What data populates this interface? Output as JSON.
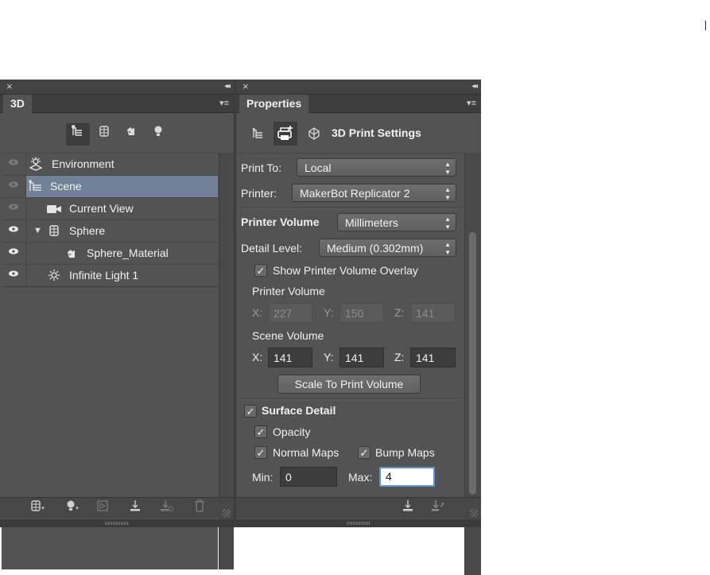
{
  "panel_3d": {
    "close_glyph": "×",
    "collapse_glyph": "◂◂",
    "tab_label": "3D",
    "menu_glyph": "▾≡",
    "filter_icons": [
      "scene-filter-icon",
      "mesh-filter-icon",
      "material-filter-icon",
      "light-filter-icon"
    ],
    "layers": [
      {
        "name": "Environment",
        "icon": "environment-icon",
        "visible": false,
        "selected": false,
        "indent": 0
      },
      {
        "name": "Scene",
        "icon": "scene-icon",
        "visible": false,
        "selected": true,
        "indent": 0
      },
      {
        "name": "Current View",
        "icon": "camera-icon",
        "visible": false,
        "selected": false,
        "indent": 1
      },
      {
        "name": "Sphere",
        "icon": "mesh-icon",
        "visible": true,
        "selected": false,
        "indent": 1,
        "expanded": true
      },
      {
        "name": "Sphere_Material",
        "icon": "material-icon",
        "visible": true,
        "selected": false,
        "indent": 2
      },
      {
        "name": "Infinite Light 1",
        "icon": "light-icon",
        "visible": true,
        "selected": false,
        "indent": 1
      }
    ],
    "bottom_icons": [
      "add-mesh-icon",
      "add-light-icon",
      "render-icon",
      "drop-to-plane-icon",
      "move-to-ground-icon",
      "delete-icon"
    ],
    "colors": {
      "selected_row": "#6f8296",
      "panel_bg": "#535353"
    }
  },
  "properties": {
    "close_glyph": "×",
    "collapse_glyph": "◂◂",
    "tab_label": "Properties",
    "menu_glyph": "▾≡",
    "mode_title": "3D Print Settings",
    "print_to_label": "Print To:",
    "print_to_value": "Local",
    "printer_label": "Printer:",
    "printer_value": "MakerBot Replicator 2",
    "printer_volume_label": "Printer Volume",
    "units_value": "Millimeters",
    "detail_level_label": "Detail Level:",
    "detail_level_value": "Medium (0.302mm)",
    "show_overlay_label": "Show Printer Volume Overlay",
    "show_overlay_checked": true,
    "printer_volume_heading": "Printer Volume",
    "printer_volume": {
      "x_label": "X:",
      "x": "227",
      "y_label": "Y:",
      "y": "150",
      "z_label": "Z:",
      "z": "141"
    },
    "scene_volume_heading": "Scene Volume",
    "scene_volume": {
      "x_label": "X:",
      "x": "141",
      "y_label": "Y:",
      "y": "141",
      "z_label": "Z:",
      "z": "141"
    },
    "scale_button": "Scale To Print Volume",
    "surface_detail_label": "Surface Detail",
    "surface_detail_checked": true,
    "opacity_label": "Opacity",
    "opacity_checked": true,
    "normal_maps_label": "Normal Maps",
    "normal_maps_checked": true,
    "bump_maps_label": "Bump Maps",
    "bump_maps_checked": true,
    "min_label": "Min:",
    "min_value": "0",
    "max_label": "Max:",
    "max_value": "4",
    "check_glyph": "✓",
    "arrows_glyph": "▲▼",
    "bottom_icons": [
      "print-icon",
      "print-utilities-icon"
    ]
  }
}
